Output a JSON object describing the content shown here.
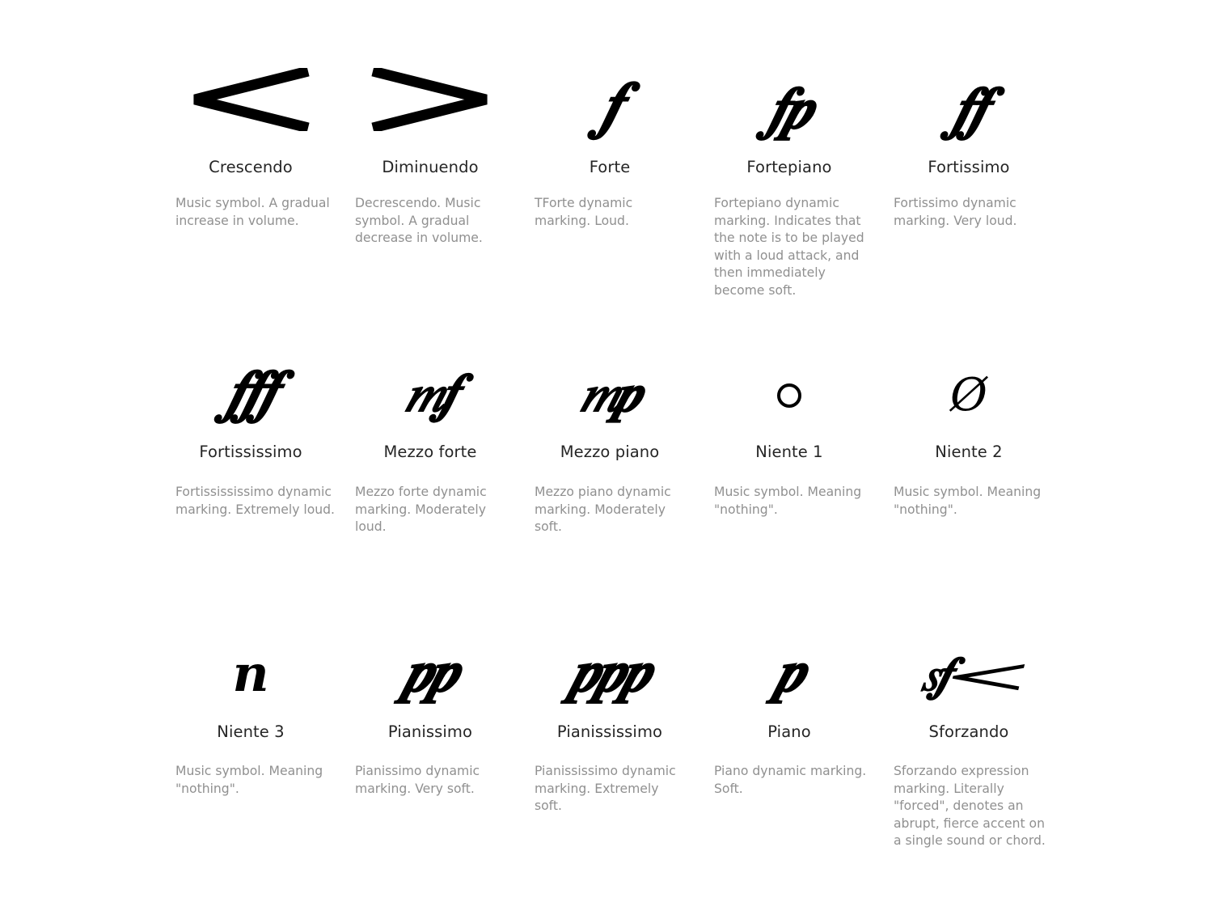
{
  "page": {
    "background_color": "#ffffff",
    "name_color": "#252525",
    "description_color": "#909090",
    "symbol_color": "#000000",
    "columns": 5,
    "rows": 3
  },
  "items": [
    {
      "name": "Crescendo",
      "description": "Music symbol. A gradual increase in volume.",
      "symbol_glyph": "<",
      "symbol_kind": "hairpin-crescendo",
      "icon_name": "crescendo-hairpin-icon"
    },
    {
      "name": "Diminuendo",
      "description": "Decrescendo. Music symbol. A gradual decrease in volume.",
      "symbol_glyph": ">",
      "symbol_kind": "hairpin-diminuendo",
      "icon_name": "diminuendo-hairpin-icon"
    },
    {
      "name": "Forte",
      "description": "TForte dynamic marking. Loud.",
      "symbol_glyph": "𝆑",
      "symbol_kind": "dynamic-text",
      "icon_name": "forte-dynamic-icon"
    },
    {
      "name": "Fortepiano",
      "description": "Fortepiano dynamic marking. Indicates that the note is to be played with a loud attack, and then immediately become soft.",
      "symbol_glyph": "𝆑𝆏",
      "symbol_kind": "dynamic-text",
      "icon_name": "fortepiano-dynamic-icon"
    },
    {
      "name": "Fortissimo",
      "description": "Fortissimo dynamic marking. Very loud.",
      "symbol_glyph": "𝆑𝆑",
      "symbol_kind": "dynamic-text",
      "icon_name": "fortissimo-dynamic-icon"
    },
    {
      "name": "Fortississimo",
      "description": "Fortissississimo dynamic marking. Extremely loud.",
      "symbol_glyph": "𝆑𝆑𝆑",
      "symbol_kind": "dynamic-text",
      "icon_name": "fortississimo-dynamic-icon"
    },
    {
      "name": "Mezzo forte",
      "description": "Mezzo forte dynamic marking. Moderately loud.",
      "symbol_glyph": "𝆐𝆑",
      "symbol_kind": "dynamic-text",
      "icon_name": "mezzo-forte-dynamic-icon"
    },
    {
      "name": "Mezzo piano",
      "description": "Mezzo piano dynamic marking. Moderately soft.",
      "symbol_glyph": "𝆐𝆏",
      "symbol_kind": "dynamic-text",
      "icon_name": "mezzo-piano-dynamic-icon"
    },
    {
      "name": "Niente 1",
      "description": "Music symbol. Meaning \"nothing\".",
      "symbol_glyph": "○",
      "symbol_kind": "circle",
      "icon_name": "niente-circle-icon"
    },
    {
      "name": "Niente 2",
      "description": "Music symbol. Meaning \"nothing\".",
      "symbol_glyph": "Ø",
      "symbol_kind": "slashed-o",
      "icon_name": "niente-slashed-o-icon"
    },
    {
      "name": "Niente 3",
      "description": "Music symbol. Meaning \"nothing\".",
      "symbol_glyph": "n",
      "symbol_kind": "letter-n",
      "icon_name": "niente-n-icon"
    },
    {
      "name": "Pianissimo",
      "description": "Pianissimo dynamic marking. Very soft.",
      "symbol_glyph": "𝆏𝆏",
      "symbol_kind": "dynamic-text",
      "icon_name": "pianissimo-dynamic-icon"
    },
    {
      "name": "Pianississimo",
      "description": "Pianississimo dynamic marking. Extremely soft.",
      "symbol_glyph": "𝆏𝆏𝆏",
      "symbol_kind": "dynamic-text",
      "icon_name": "pianississimo-dynamic-icon"
    },
    {
      "name": "Piano",
      "description": "Piano dynamic marking. Soft.",
      "symbol_glyph": "𝆏",
      "symbol_kind": "dynamic-text",
      "icon_name": "piano-dynamic-icon"
    },
    {
      "name": "Sforzando",
      "description": "Sforzando expression marking. Literally \"forced\", denotes an abrupt, fierce accent on a single sound or chord.",
      "symbol_glyph": "𝆍𝆑𝆒",
      "symbol_kind": "dynamic-text",
      "icon_name": "sforzando-dynamic-icon"
    }
  ]
}
